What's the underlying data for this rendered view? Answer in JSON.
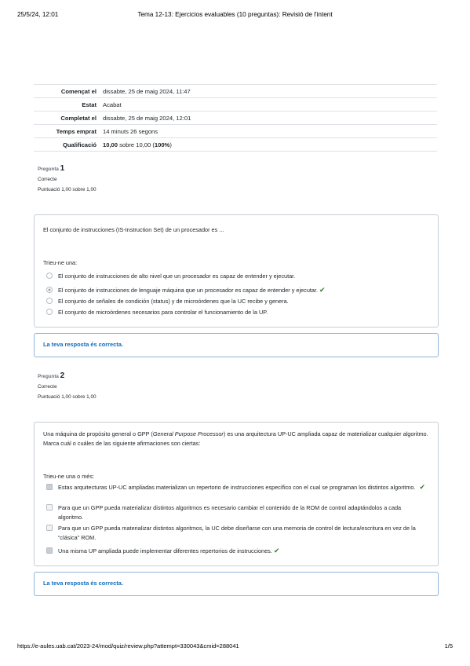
{
  "print_header": {
    "datetime": "25/5/24, 12:01",
    "title": "Tema 12-13: Ejercicios evaluables (10 preguntas): Revisió de l'intent"
  },
  "summary": [
    {
      "label": "Començat el",
      "value": "dissabte, 25 de maig 2024, 11:47"
    },
    {
      "label": "Estat",
      "value": "Acabat"
    },
    {
      "label": "Completat el",
      "value": "dissabte, 25 de maig 2024, 12:01"
    },
    {
      "label": "Temps emprat",
      "value": "14 minuts 26 segons"
    },
    {
      "label": "Qualificació",
      "grade": "10,00",
      "between": " sobre 10,00 (",
      "percent": "100%",
      "close": ")"
    }
  ],
  "questions": [
    {
      "label": "Pregunta",
      "number": "1",
      "state": "Correcte",
      "grade": "Puntuació 1,00 sobre 1,00",
      "text": "El conjunto de instrucciones (IS-Instruction Set) de un procesador es ...",
      "prompt": "Trieu-ne una:",
      "answers": [
        {
          "text": "El conjunto de instrucciones de alto nivel que un procesador es capaz de entender y ejecutar.",
          "checked": false,
          "correct": false
        },
        {
          "text": "El conjunto de instrucciones de lenguaje máquina que un procesador es capaz de entender y ejecutar.",
          "checked": true,
          "correct": true
        },
        {
          "text": "El conjunto de señales de condición (status) y de microórdenes que la UC recibe y genera.",
          "checked": false,
          "correct": false
        },
        {
          "text": "El conjunto de microórdenes necesarios para controlar el funcionamiento de la UP.",
          "checked": false,
          "correct": false
        }
      ],
      "feedback": "La teva resposta és correcta."
    },
    {
      "label": "Pregunta",
      "number": "2",
      "state": "Correcte",
      "grade": "Puntuació 1,00 sobre 1,00",
      "text_before": "Una máquina de propósito general o GPP (",
      "text_italic": "General Purpose Processor",
      "text_after": ") es una arquitectura UP-UC ampliada capaz de materializar cualquier algoritmo. Marca cuál o cuáles de las siguiente afirmaciones son ciertas:",
      "prompt": "Trieu-ne una o més:",
      "answers": [
        {
          "text": "Estas arquitecturas UP-UC ampliadas materializan un repertorio de instrucciones específico con el cual se programan los distintos algoritmo.",
          "checked": true,
          "correct": true
        },
        {
          "text": "Para que un GPP pueda materializar distintos algoritmos es necesario cambiar el contenido de la ROM de control adaptándolos a cada algoritmo.",
          "checked": false,
          "correct": false
        },
        {
          "text": "Para que un GPP pueda materializar distintos algoritmos, la UC debe diseñarse con una memoria de control de lectura/escritura en vez de la “clásica” ROM.",
          "checked": false,
          "correct": false
        },
        {
          "text": "Una misma UP ampliada puede implementar diferentes repertorios de instrucciones.",
          "checked": true,
          "correct": true
        }
      ],
      "feedback": "La teva resposta és correcta."
    }
  ],
  "print_footer": {
    "url": "https://e-aules.uab.cat/2023-24/mod/quiz/review.php?attempt=330043&cmid=288041",
    "page": "1/5"
  },
  "colors": {
    "correct": "#357a32",
    "feedback_text": "#0f6cbf",
    "feedback_border": "#92b5da"
  },
  "icons": {
    "correct": "check-icon"
  }
}
